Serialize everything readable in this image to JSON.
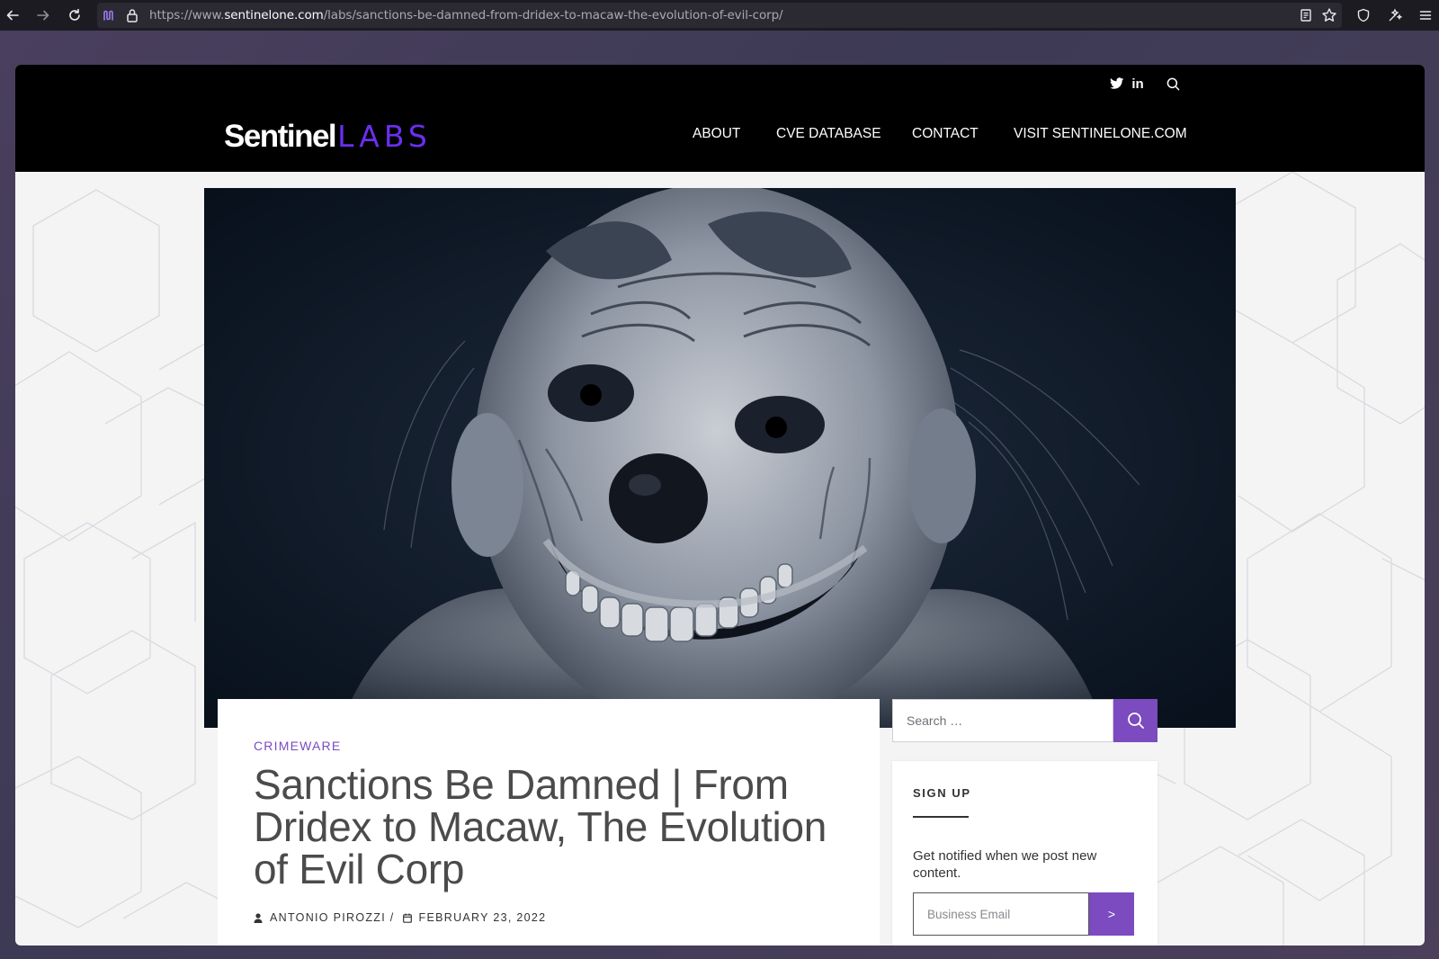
{
  "browser": {
    "url_prefix": "https://www.",
    "url_host": "sentinelone.com",
    "url_path": "/labs/sanctions-be-damned-from-dridex-to-macaw-the-evolution-of-evil-corp/"
  },
  "header": {
    "logo_primary": "Sentinel",
    "logo_secondary": "LABS",
    "social": [
      "twitter-icon",
      "linkedin-icon"
    ],
    "linkedin_text": "in",
    "nav": {
      "about": "ABOUT",
      "cve": "CVE DATABASE",
      "contact": "CONTACT",
      "visit": "VISIT SENTINELONE.COM"
    }
  },
  "article": {
    "category": "CRIMEWARE",
    "title": "Sanctions Be Damned | From Dridex to Macaw, The Evolution of Evil Corp",
    "author": "ANTONIO PIROZZI /",
    "date": "FEBRUARY 23, 2022"
  },
  "sidebar": {
    "search_placeholder": "Search …",
    "signup_title": "SIGN UP",
    "signup_desc": "Get notified when we post new content.",
    "email_placeholder": "Business Email",
    "submit_label": ">"
  },
  "colors": {
    "accent": "#7b4bbf",
    "logo_accent": "#6a2ff0",
    "header_bg": "#000000"
  }
}
